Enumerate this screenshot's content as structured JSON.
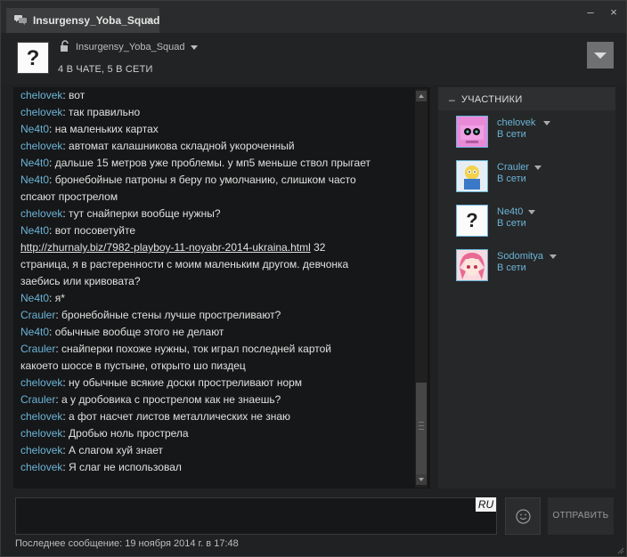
{
  "window": {
    "tab_title": "Insurgensy_Yoba_Squad",
    "tab_close": "×",
    "minimize": "–",
    "close": "×"
  },
  "header": {
    "group_avatar": "?",
    "group_name": "Insurgensy_Yoba_Squad",
    "status": "4 В ЧАТЕ, 5 В СЕТИ"
  },
  "chat": {
    "messages": [
      {
        "user": "chelovek",
        "text": "вот"
      },
      {
        "user": "chelovek",
        "text": "так правильно"
      },
      {
        "user": "Ne4t0",
        "text": "на маленьких картах"
      },
      {
        "user": "chelovek",
        "text": "автомат калашникова складной укороченный"
      },
      {
        "user": "Ne4t0",
        "text": "дальше 15 метров уже проблемы. у мп5 меньше ствол прыгает"
      },
      {
        "user": "Ne4t0",
        "text": "бронебойные патроны я беру по умолчанию, слишком часто"
      },
      {
        "user": "",
        "text": "спсают прострелом"
      },
      {
        "user": "chelovek",
        "text": "тут снайперки вообще нужны?"
      },
      {
        "user": "Ne4t0",
        "text": "вот посоветуйте"
      },
      {
        "user": "",
        "link": "http://zhurnaly.biz/7982-playboy-11-noyabr-2014-ukraina.html",
        "text": "32"
      },
      {
        "user": "",
        "text": "страница, я в растеренности с моим маленьким другом. девчонка"
      },
      {
        "user": "",
        "text": "заебись или кривовата?"
      },
      {
        "user": "Ne4t0",
        "text": "я*"
      },
      {
        "user": "Crauler",
        "text": "бронебойные стены лучше простреливают?"
      },
      {
        "user": "Ne4t0",
        "text": "обычные вообще этого не делают"
      },
      {
        "user": "Crauler",
        "text": "снайперки похоже нужны, ток играл последней картой"
      },
      {
        "user": "",
        "text": "какоето шоссе в пустыне, открыто шо пиздец"
      },
      {
        "user": "chelovek",
        "text": "ну обычные всякие доски простреливают норм"
      },
      {
        "user": "Crauler",
        "text": "а у дробовика с прострелом как не знаешь?"
      },
      {
        "user": "chelovek",
        "text": "а фот насчет листов металлических не знаю"
      },
      {
        "user": "chelovek",
        "text": "Дробью ноль прострела"
      },
      {
        "user": "chelovek",
        "text": "А слагом хуй знает"
      },
      {
        "user": "chelovek",
        "text": "Я слаг не использовал"
      }
    ]
  },
  "members": {
    "collapse": "–",
    "title": "УЧАСТНИКИ",
    "list": [
      {
        "name": "chelovek",
        "status": "В сети",
        "avatar": "pink-robot"
      },
      {
        "name": "Crauler",
        "status": "В сети",
        "avatar": "cartoon"
      },
      {
        "name": "Ne4t0",
        "status": "В сети",
        "avatar": "?"
      },
      {
        "name": "Sodomitya",
        "status": "В сети",
        "avatar": "anime-girl"
      }
    ]
  },
  "input": {
    "language": "RU",
    "send_label": "ОТПРАВИТЬ"
  },
  "footer": {
    "last_message": "Последнее сообщение: 19 ноября 2014 г. в 17:48"
  },
  "colors": {
    "username": "#6ab4d8",
    "background": "#202122",
    "chat_bg": "#161718"
  }
}
